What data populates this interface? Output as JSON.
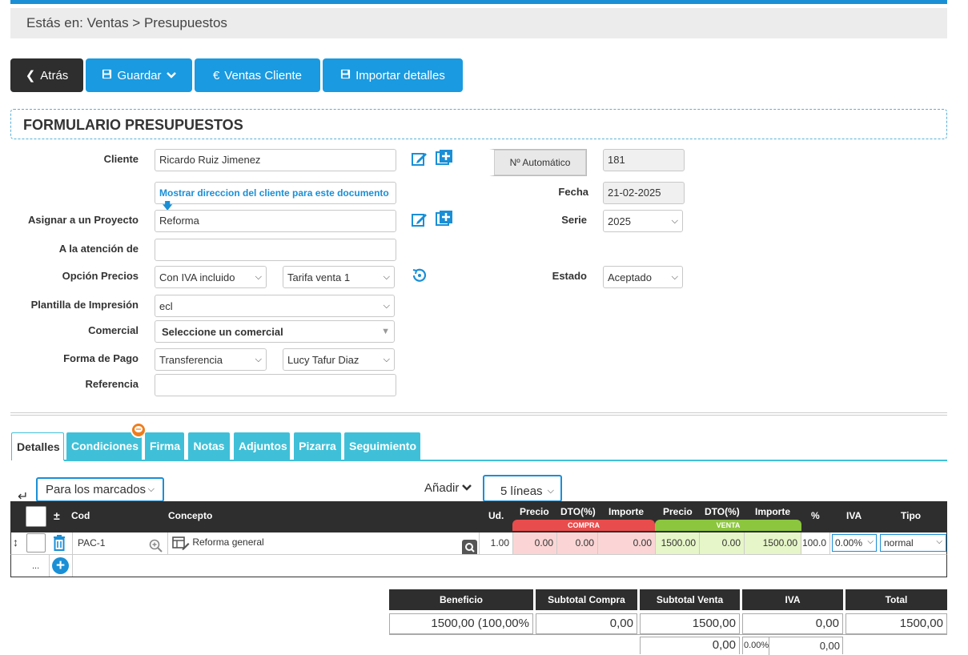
{
  "breadcrumb": "Estás en: Ventas > Presupuestos",
  "toolbar": {
    "back": "Atrás",
    "save": "Guardar",
    "sales": "Ventas Cliente",
    "import": "Importar detalles"
  },
  "form": {
    "title": "FORMULARIO PRESUPUESTOS",
    "cliente_label": "Cliente",
    "cliente_value": "Ricardo Ruiz Jimenez",
    "show_address": "Mostrar direccion del cliente para este documento",
    "proyecto_label": "Asignar a un Proyecto",
    "proyecto_value": "Reforma",
    "atencion_label": "A la atención de",
    "opcion_label": "Opción Precios",
    "opcion_value": "Con IVA incluido",
    "tarifa_value": "Tarifa venta 1",
    "plantilla_label": "Plantilla de Impresión",
    "plantilla_value": "ecl",
    "comercial_label": "Comercial",
    "comercial_value": "Seleccione un comercial",
    "pago_label": "Forma de Pago",
    "pago_value": "Transferencia",
    "pago_person": "Lucy Tafur Diaz",
    "referencia_label": "Referencia",
    "auto_button": "Nº Automático",
    "numero": "181",
    "fecha_label": "Fecha",
    "fecha_value": "21-02-2025",
    "serie_label": "Serie",
    "serie_value": "2025",
    "estado_label": "Estado",
    "estado_value": "Aceptado"
  },
  "tabs": [
    "Detalles",
    "Condiciones",
    "Firma",
    "Notas",
    "Adjuntos",
    "Pizarra",
    "Seguimiento"
  ],
  "lines": {
    "bulk_select": "Para los marcados",
    "add_label": "Añadir",
    "lines_select": "5 líneas"
  },
  "table": {
    "headers": {
      "cod": "Cod",
      "concepto": "Concepto",
      "ud": "Ud.",
      "precio_c": "Precio",
      "dto_c": "DTO(%)",
      "importe_c": "Importe",
      "precio_v": "Precio",
      "dto_v": "DTO(%)",
      "importe_v": "Importe",
      "pct": "%",
      "iva": "IVA",
      "tipo": "Tipo",
      "compra": "COMPRA",
      "venta": "VENTA"
    },
    "row": {
      "cod": "PAC-1",
      "concepto": "Reforma general",
      "ud": "1.00",
      "precio_c": "0.00",
      "dto_c": "0.00",
      "importe_c": "0.00",
      "precio_v": "1500.00",
      "dto_v": "0.00",
      "importe_v": "1500.00",
      "pct": "100.0",
      "iva": "0.00%",
      "tipo": "normal"
    },
    "add_row_dots": "..."
  },
  "summary": {
    "beneficio_label": "Beneficio",
    "beneficio": "1500,00 (100,00%",
    "subtotal_compra_label": "Subtotal Compra",
    "subtotal_compra": "0,00",
    "subtotal_venta_label": "Subtotal Venta",
    "subtotal_venta": "1500,00",
    "iva_label": "IVA",
    "iva": "0,00",
    "total_label": "Total",
    "total": "1500,00",
    "row2_base": "0,00",
    "row2_pct": "0.00%",
    "row2_iva": "0,00"
  },
  "colors": {
    "accent": "#1a9ae0",
    "tab": "#3fc0d8",
    "compra": "#e84c4c",
    "venta": "#8cc63f"
  }
}
